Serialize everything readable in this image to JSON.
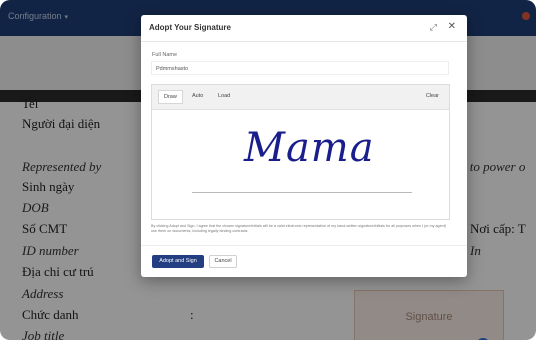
{
  "nav": {
    "menu_label": "Configuration",
    "menu_chevron": "▾"
  },
  "document": {
    "lines": [
      "Tel",
      "Người đại diện",
      "Represented by",
      "Sinh ngày",
      "DOB",
      "Số CMT",
      "ID number",
      "Địa chỉ cư trú",
      "Address",
      "Chức danh",
      "Job title"
    ],
    "colon": ":",
    "right_represented": "g to power o",
    "right_noi_cap": "Nơi cấp: T",
    "right_in": "In",
    "signature_placeholder": "Signature"
  },
  "modal": {
    "title": "Adopt Your Signature",
    "expand_glyph": "⤢",
    "close_glyph": "✕",
    "full_name_label": "Full Name",
    "full_name_value": "Pdmmshasto",
    "tabs": {
      "draw": "Draw",
      "auto": "Auto",
      "load": "Load"
    },
    "clear_label": "Clear",
    "signature": "Mama",
    "disclaimer": "By clicking Adopt and Sign, I agree that the chosen signature/initials will be a valid electronic representation of my hand-written signature/initials for all purposes when I (or my agent) use them on documents, including legally binding contracts.",
    "adopt_button": "Adopt and Sign",
    "cancel_button": "Cancel"
  },
  "colors": {
    "nav_bg": "#1f3f78",
    "adopt_bg": "#233f82",
    "signature_ink": "#1a1e8c",
    "signature_box_bg": "#fbeee7"
  }
}
